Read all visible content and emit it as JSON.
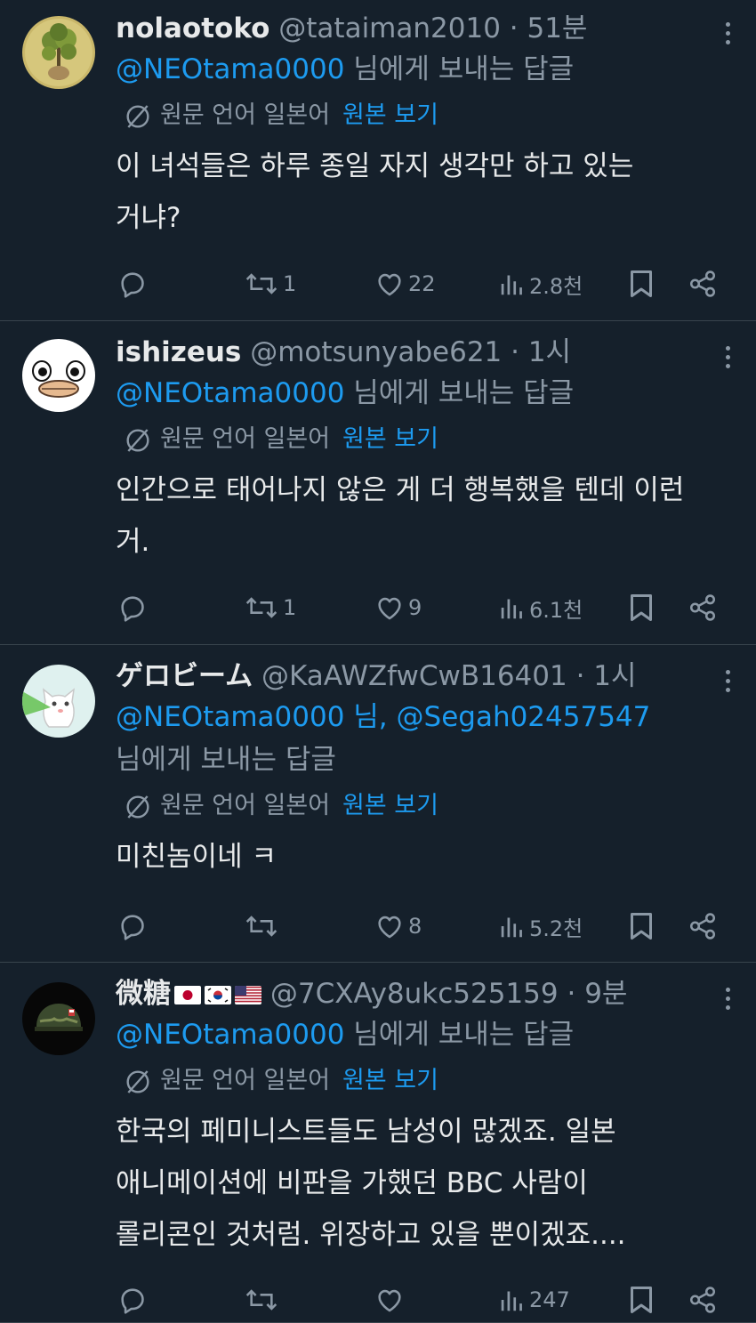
{
  "tweets": [
    {
      "name": "nolaotoko",
      "handle": "@tataiman2010",
      "time": "51분",
      "reply_parts": [
        {
          "text": "@NEOtama0000",
          "mention": true
        },
        {
          "text": " 님에게 보내는 답글",
          "mention": false
        }
      ],
      "translate_label": "원문 언어 일본어",
      "translate_link": "원본 보기",
      "body_lines": [
        "이 녀석들은 하루 종일 자지 생각만 하고 있는",
        "거냐?"
      ],
      "replies": "",
      "retweets": "1",
      "likes": "22",
      "views": "2.8천"
    },
    {
      "name": "ishizeus",
      "handle": "@motsunyabe621",
      "time": "1시",
      "reply_parts": [
        {
          "text": "@NEOtama0000",
          "mention": true
        },
        {
          "text": " 님에게 보내는 답글",
          "mention": false
        }
      ],
      "translate_label": "원문 언어 일본어",
      "translate_link": "원본 보기",
      "body_lines": [
        "인간으로 태어나지 않은 게 더 행복했을 텐데 이런",
        "거."
      ],
      "replies": "",
      "retweets": "1",
      "likes": "9",
      "views": "6.1천"
    },
    {
      "name": "ゲロビーム",
      "handle": "@KaAWZfwCwB16401",
      "time": "1시",
      "reply_parts": [
        {
          "text": "@NEOtama0000",
          "mention": true
        },
        {
          "text": " 님, ",
          "mention": true
        },
        {
          "text": "@Segah02457547",
          "mention": true
        },
        {
          "text": "\n님에게 보내는 답글",
          "mention": false
        }
      ],
      "translate_label": "원문 언어 일본어",
      "translate_link": "원본 보기",
      "body_lines": [
        "미친놈이네 ㅋ"
      ],
      "replies": "",
      "retweets": "",
      "likes": "8",
      "views": "5.2천"
    },
    {
      "name": "微糖",
      "name_flags": [
        "japan-flag",
        "korea-flag",
        "usa-flag"
      ],
      "handle": "@7CXAy8ukc525159",
      "time": "9분",
      "reply_parts": [
        {
          "text": "@NEOtama0000",
          "mention": true
        },
        {
          "text": " 님에게 보내는 답글",
          "mention": false
        }
      ],
      "translate_label": "원문 언어 일본어",
      "translate_link": "원본 보기",
      "body_lines": [
        "한국의 페미니스트들도 남성이 많겠죠. 일본",
        "애니메이션에 비판을 가했던 BBC 사람이",
        "롤리콘인 것처럼. 위장하고 있을 뿐이겠죠...."
      ],
      "replies": "",
      "retweets": "",
      "likes": "",
      "views": "247"
    }
  ],
  "separator": " · ",
  "colors": {
    "background": "#15202b",
    "text": "#e7e9ea",
    "muted": "#8b98a5",
    "accent": "#1d9bf0",
    "border": "#38444d"
  },
  "icons": {
    "reply": "reply-icon",
    "retweet": "retweet-icon",
    "like": "heart-icon",
    "views": "views-icon",
    "bookmark": "bookmark-icon",
    "share": "share-icon",
    "translate": "translate-icon",
    "more": "more-icon"
  }
}
